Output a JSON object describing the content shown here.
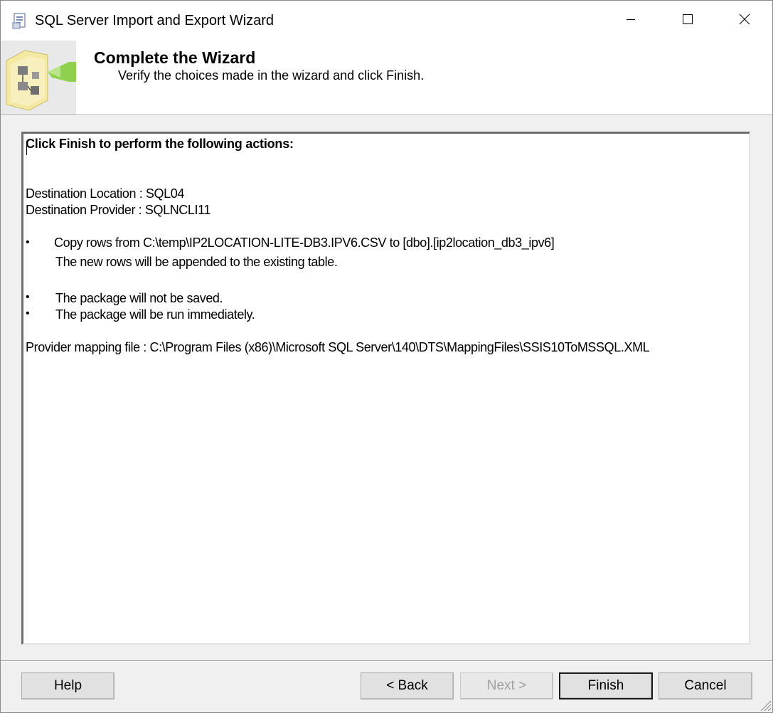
{
  "window": {
    "title": "SQL Server Import and Export Wizard"
  },
  "header": {
    "title": "Complete the Wizard",
    "subtitle": "Verify the choices made in the wizard and click Finish."
  },
  "summary": {
    "heading": "Click Finish to perform the following actions:",
    "destination_location": "Destination Location : SQL04",
    "destination_provider": "Destination Provider : SQLNCLI11",
    "bullet_glyph": "•",
    "copy_action": "Copy rows from C:\\temp\\IP2LOCATION-LITE-DB3.IPV6.CSV to [dbo].[ip2location_db3_ipv6]",
    "copy_note": "The new rows will be appended to the existing table.",
    "package_not_saved": "The package will not be saved.",
    "package_run": "The package will be run immediately.",
    "mapping_file": "Provider mapping file : C:\\Program Files (x86)\\Microsoft SQL Server\\140\\DTS\\MappingFiles\\SSIS10ToMSSQL.XML"
  },
  "buttons": {
    "help": "Help",
    "back": "< Back",
    "next": "Next >",
    "finish": "Finish",
    "cancel": "Cancel"
  },
  "icons": {
    "app": "wizard-app-icon",
    "header_art": "wizard-folder-arrow-art",
    "minimize": "minimize-icon",
    "maximize": "maximize-icon",
    "close": "close-icon",
    "grip": "resize-grip-icon"
  },
  "colors": {
    "chrome": "#f0f0f0",
    "button_face": "#e1e1e1",
    "disabled_text": "#a0a0a0",
    "art_folder": "#f3e9a3",
    "art_arrow": "#8fd14f"
  },
  "state": {
    "next_enabled": false,
    "default_button": "finish"
  }
}
